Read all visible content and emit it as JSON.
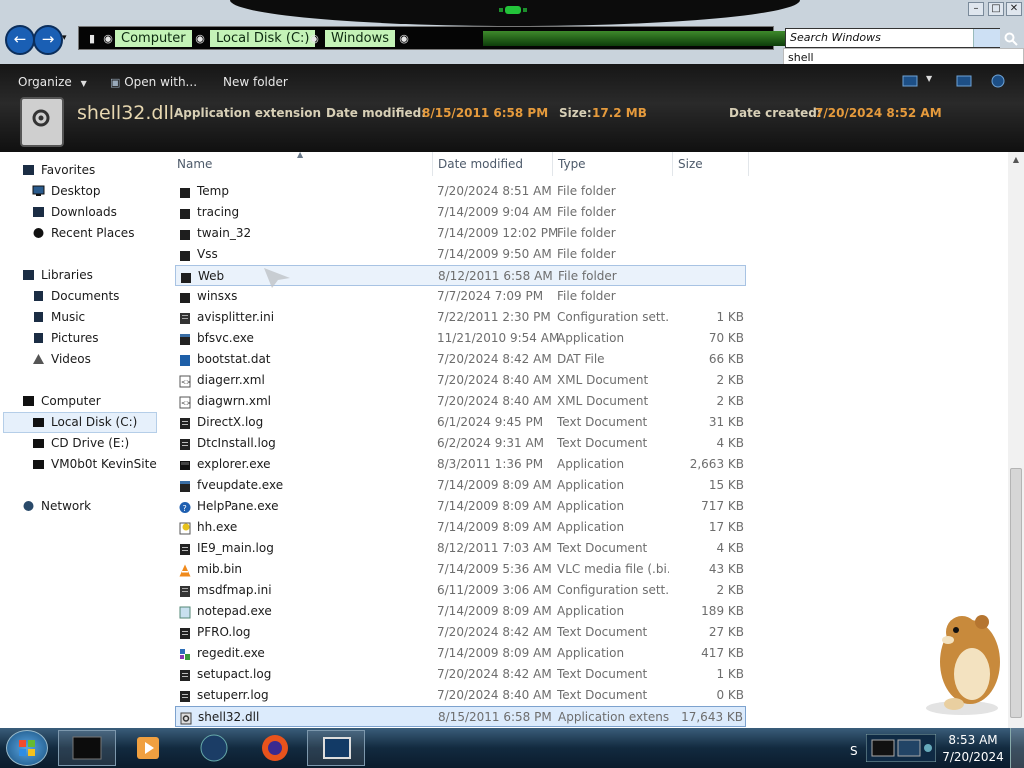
{
  "window": {
    "search_placeholder": "Search Windows",
    "search_suggestion": "shell",
    "controls": [
      "–",
      "□",
      "✕"
    ]
  },
  "address": {
    "crumbs": [
      "Computer",
      "Local Disk (C:)",
      "Windows"
    ],
    "dropdown_glyph": "▽",
    "refresh_glyph": "⟳"
  },
  "toolbar": {
    "organize": "Organize",
    "open_with": "Open with...",
    "new_folder": "New folder"
  },
  "details": {
    "file_name": "shell32.dll",
    "file_type": "Application extension",
    "date_modified_label": "Date modified:",
    "date_modified": "8/15/2011 6:58 PM",
    "size_label": "Size:",
    "size": "17.2 MB",
    "date_created_label": "Date created:",
    "date_created": "7/20/2024 8:52 AM"
  },
  "nav": {
    "favorites": "Favorites",
    "desktop": "Desktop",
    "downloads": "Downloads",
    "recent": "Recent Places",
    "libraries": "Libraries",
    "documents": "Documents",
    "music": "Music",
    "pictures": "Pictures",
    "videos": "Videos",
    "computer": "Computer",
    "local_disk": "Local Disk (C:)",
    "cd_drive": "CD Drive (E:)",
    "vmshare": "VM0b0t KevinSite",
    "network": "Network"
  },
  "columns": {
    "name": "Name",
    "date": "Date modified",
    "type": "Type",
    "size": "Size"
  },
  "files": [
    {
      "name": "Temp",
      "date": "7/20/2024 8:51 AM",
      "type": "File folder",
      "size": "",
      "icon": "folder-icon"
    },
    {
      "name": "tracing",
      "date": "7/14/2009 9:04 AM",
      "type": "File folder",
      "size": "",
      "icon": "folder-icon"
    },
    {
      "name": "twain_32",
      "date": "7/14/2009 12:02 PM",
      "type": "File folder",
      "size": "",
      "icon": "folder-icon"
    },
    {
      "name": "Vss",
      "date": "7/14/2009 9:50 AM",
      "type": "File folder",
      "size": "",
      "icon": "folder-icon"
    },
    {
      "name": "Web",
      "date": "8/12/2011 6:58 AM",
      "type": "File folder",
      "size": "",
      "icon": "folder-icon"
    },
    {
      "name": "winsxs",
      "date": "7/7/2024 7:09 PM",
      "type": "File folder",
      "size": "",
      "icon": "folder-icon"
    },
    {
      "name": "avisplitter.ini",
      "date": "7/22/2011 2:30 PM",
      "type": "Configuration sett...",
      "size": "1 KB",
      "icon": "config-file-icon"
    },
    {
      "name": "bfsvc.exe",
      "date": "11/21/2010 9:54 AM",
      "type": "Application",
      "size": "70 KB",
      "icon": "application-icon"
    },
    {
      "name": "bootstat.dat",
      "date": "7/20/2024 8:42 AM",
      "type": "DAT File",
      "size": "66 KB",
      "icon": "dat-file-icon"
    },
    {
      "name": "diagerr.xml",
      "date": "7/20/2024 8:40 AM",
      "type": "XML Document",
      "size": "2 KB",
      "icon": "xml-file-icon"
    },
    {
      "name": "diagwrn.xml",
      "date": "7/20/2024 8:40 AM",
      "type": "XML Document",
      "size": "2 KB",
      "icon": "xml-file-icon"
    },
    {
      "name": "DirectX.log",
      "date": "6/1/2024 9:45 PM",
      "type": "Text Document",
      "size": "31 KB",
      "icon": "text-file-icon"
    },
    {
      "name": "DtcInstall.log",
      "date": "6/2/2024 9:31 AM",
      "type": "Text Document",
      "size": "4 KB",
      "icon": "text-file-icon"
    },
    {
      "name": "explorer.exe",
      "date": "8/3/2011 1:36 PM",
      "type": "Application",
      "size": "2,663 KB",
      "icon": "explorer-icon"
    },
    {
      "name": "fveupdate.exe",
      "date": "7/14/2009 8:09 AM",
      "type": "Application",
      "size": "15 KB",
      "icon": "application-icon"
    },
    {
      "name": "HelpPane.exe",
      "date": "7/14/2009 8:09 AM",
      "type": "Application",
      "size": "717 KB",
      "icon": "help-icon"
    },
    {
      "name": "hh.exe",
      "date": "7/14/2009 8:09 AM",
      "type": "Application",
      "size": "17 KB",
      "icon": "help-document-icon"
    },
    {
      "name": "IE9_main.log",
      "date": "8/12/2011 7:03 AM",
      "type": "Text Document",
      "size": "4 KB",
      "icon": "text-file-icon"
    },
    {
      "name": "mib.bin",
      "date": "7/14/2009 5:36 AM",
      "type": "VLC media file (.bi...",
      "size": "43 KB",
      "icon": "vlc-icon"
    },
    {
      "name": "msdfmap.ini",
      "date": "6/11/2009 3:06 AM",
      "type": "Configuration sett...",
      "size": "2 KB",
      "icon": "config-file-icon"
    },
    {
      "name": "notepad.exe",
      "date": "7/14/2009 8:09 AM",
      "type": "Application",
      "size": "189 KB",
      "icon": "notepad-icon"
    },
    {
      "name": "PFRO.log",
      "date": "7/20/2024 8:42 AM",
      "type": "Text Document",
      "size": "27 KB",
      "icon": "text-file-icon"
    },
    {
      "name": "regedit.exe",
      "date": "7/14/2009 8:09 AM",
      "type": "Application",
      "size": "417 KB",
      "icon": "regedit-icon"
    },
    {
      "name": "setupact.log",
      "date": "7/20/2024 8:42 AM",
      "type": "Text Document",
      "size": "1 KB",
      "icon": "text-file-icon"
    },
    {
      "name": "setuperr.log",
      "date": "7/20/2024 8:40 AM",
      "type": "Text Document",
      "size": "0 KB",
      "icon": "text-file-icon"
    },
    {
      "name": "shell32.dll",
      "date": "8/15/2011 6:58 PM",
      "type": "Application extens...",
      "size": "17,643 KB",
      "icon": "dll-file-icon"
    }
  ],
  "selected_row": "shell32.dll",
  "hover_row": "Web",
  "taskbar": {
    "time": "8:53 AM",
    "date": "7/20/2024",
    "tray_letter": "S"
  },
  "colors": {
    "address_crumb_bg": "#c4f3b7",
    "details_value": "#e59a3c",
    "selection_bg": "#dcebfc",
    "taskbar": "#122a3f"
  }
}
